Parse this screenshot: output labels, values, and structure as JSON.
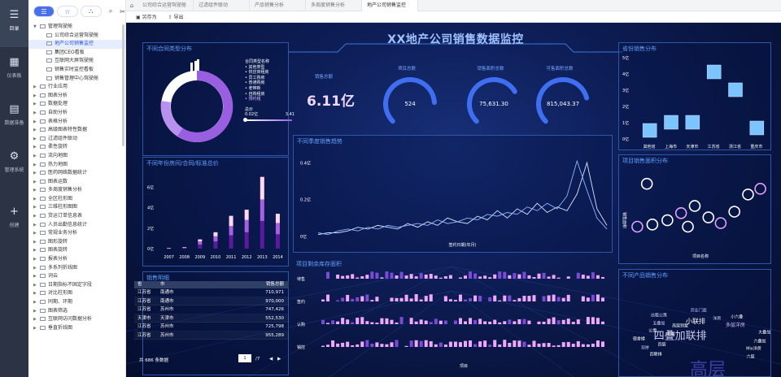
{
  "rail": {
    "items": [
      {
        "label": "目录",
        "icon": "☰"
      },
      {
        "label": "仪表板",
        "icon": "▦"
      },
      {
        "label": "数据准备",
        "icon": "▤"
      },
      {
        "label": "管理系统",
        "icon": "⚙"
      },
      {
        "label": "创建",
        "icon": "+"
      }
    ]
  },
  "tree": {
    "nodes": [
      {
        "label": "管理驾驶舱",
        "level": 0,
        "open": true
      },
      {
        "label": "公司综合运营驾驶舱",
        "level": 1
      },
      {
        "label": "地产公司销售监控",
        "level": 1,
        "selected": true
      },
      {
        "label": "集团CEO看板",
        "level": 1
      },
      {
        "label": "互联网大屏驾驶舱",
        "level": 1
      },
      {
        "label": "销售实时监控看板",
        "level": 1
      },
      {
        "label": "销售管理中心驾驶舱",
        "level": 1
      },
      {
        "label": "行业应用",
        "level": 0
      },
      {
        "label": "图表分析",
        "level": 0
      },
      {
        "label": "数据处理",
        "level": 0
      },
      {
        "label": "自助分析",
        "level": 0
      },
      {
        "label": "表格分析",
        "level": 0
      },
      {
        "label": "高级图表特性数据",
        "level": 0
      },
      {
        "label": "过滤组件联动",
        "level": 0
      },
      {
        "label": "柔性旋转",
        "level": 0
      },
      {
        "label": "流向地图",
        "level": 0
      },
      {
        "label": "热力地图",
        "level": 0
      },
      {
        "label": "医药网络数据统计",
        "level": 0
      },
      {
        "label": "图表运数",
        "level": 0
      },
      {
        "label": "多周度销售分析",
        "level": 0
      },
      {
        "label": "全区柱形图",
        "level": 0
      },
      {
        "label": "三维柱形图图",
        "level": 0
      },
      {
        "label": "货运订单信息表",
        "level": 0
      },
      {
        "label": "人员出勤信息统计",
        "level": 0
      },
      {
        "label": "常规业务分析",
        "level": 0
      },
      {
        "label": "图形旋转",
        "level": 0
      },
      {
        "label": "图表旋转",
        "level": 0
      },
      {
        "label": "报表分析",
        "level": 0
      },
      {
        "label": "多系列折线图",
        "level": 0
      },
      {
        "label": "词云",
        "level": 0
      },
      {
        "label": "日期指标不固定字段",
        "level": 0
      },
      {
        "label": "对比柱形图",
        "level": 0
      },
      {
        "label": "同期、环期",
        "level": 0
      },
      {
        "label": "图表筛选",
        "level": 0
      },
      {
        "label": "互联网访问数据分析",
        "level": 0
      },
      {
        "label": "垂直折线图",
        "level": 0
      }
    ]
  },
  "tabs": [
    "公司综合运营驾驶舱",
    "过滤组件联动",
    "产品销售分析",
    "多周度销售分析",
    "地产公司销售监控"
  ],
  "toolbar": {
    "save": "另存为",
    "export": "导出"
  },
  "dashboard": {
    "title": "XX地产公司销售数据监控",
    "donut": {
      "title": "不同合同类型分布",
      "legend_title": "合同类型名称",
      "legend": [
        "其他类型",
        "供应商租房",
        "员工购房",
        "普通购房",
        "老带新",
        "自购租房",
        "预约租"
      ],
      "total_label": "总价",
      "range_min": "0.02亿",
      "range_max": "3.41"
    },
    "kpis": [
      {
        "label": "销售总额",
        "value": "6.11亿"
      },
      {
        "label": "项目总数",
        "value": "524",
        "fraction": 0.82
      },
      {
        "label": "销售面积总数",
        "value": "75,631.30",
        "fraction": 0.72
      },
      {
        "label": "可售面积总数",
        "value": "815,043.37",
        "fraction": 0.78
      }
    ],
    "province": {
      "title": "省份销售分布",
      "ylabels": [
        "5亿",
        "4亿",
        "3亿",
        "2亿",
        "1亿",
        "0亿"
      ],
      "cities": [
        "其他省",
        "上海市",
        "天津市",
        "江苏省",
        "浙江省",
        "重庆市"
      ],
      "values": [
        0.5,
        1.0,
        1.0,
        4.1,
        3.0,
        0.65
      ]
    },
    "stack": {
      "title": "不同年份房间/合同/标准总价",
      "ylabels": [
        "6亿",
        "4亿",
        "2亿",
        "0亿"
      ],
      "years": [
        "2007",
        "2008",
        "2009",
        "2010",
        "2011",
        "2012",
        "2013",
        "2014"
      ],
      "values": [
        [
          0.02,
          0.02,
          0.02
        ],
        [
          0.05,
          0.05,
          0.05
        ],
        [
          0.4,
          0.3,
          0.2
        ],
        [
          0.7,
          0.5,
          0.4
        ],
        [
          1.3,
          0.9,
          1.0
        ],
        [
          1.6,
          1.2,
          1.0
        ],
        [
          2.7,
          2.1,
          2.2
        ],
        [
          1.4,
          1.1,
          0.9
        ]
      ]
    },
    "trend": {
      "title": "不同季度销售趋势",
      "ylabels": [
        "0.4亿",
        "0.2亿",
        "0亿"
      ],
      "xlabel": "签约日期(年月)",
      "series_a": [
        0.01,
        0.02,
        0.02,
        0.03,
        0.05,
        0.04,
        0.06,
        0.05,
        0.04,
        0.07,
        0.05,
        0.08,
        0.06,
        0.1,
        0.08,
        0.07,
        0.11,
        0.09,
        0.14,
        0.1,
        0.15,
        0.12,
        0.18,
        0.13,
        0.16,
        0.14,
        0.23,
        0.4,
        0.15,
        0.06
      ],
      "series_b": [
        0.02,
        0.01,
        0.03,
        0.04,
        0.03,
        0.05,
        0.04,
        0.06,
        0.05,
        0.06,
        0.07,
        0.06,
        0.09,
        0.07,
        0.08,
        0.1,
        0.09,
        0.12,
        0.11,
        0.13,
        0.12,
        0.16,
        0.14,
        0.18,
        0.15,
        0.22,
        0.41,
        0.25,
        0.1,
        0.04
      ]
    },
    "area": {
      "title": "项目销售面积分布",
      "ylabel": "销售面积",
      "xlabel": "项目名称",
      "points": [
        [
          0.05,
          0.25
        ],
        [
          0.16,
          0.28
        ],
        [
          0.27,
          0.34
        ],
        [
          0.37,
          0.44
        ],
        [
          0.47,
          0.54
        ],
        [
          0.57,
          0.38
        ],
        [
          0.66,
          0.3
        ],
        [
          0.76,
          0.46
        ],
        [
          0.86,
          0.7
        ],
        [
          0.95,
          0.78
        ],
        [
          0.12,
          0.85
        ],
        [
          0.42,
          0.25
        ]
      ]
    },
    "table": {
      "title": "销售明细",
      "headers": [
        "省",
        "市",
        "销售总额"
      ],
      "rows": [
        [
          "江苏省",
          "南通市",
          "710,971"
        ],
        [
          "江苏省",
          "南通市",
          "970,000"
        ],
        [
          "江苏省",
          "苏州市",
          "747,426"
        ],
        [
          "天津市",
          "天津市",
          "552,530"
        ],
        [
          "江苏省",
          "苏州市",
          "725,798"
        ],
        [
          "江苏省",
          "苏州市",
          "955,289"
        ]
      ],
      "footer": "共 686 条数据",
      "page": "1",
      "pages": "/7"
    },
    "inventory": {
      "title": "项目剩余库存面积",
      "rows": [
        "待售",
        "签约",
        "认购",
        "销控"
      ],
      "xlabel": "项目"
    },
    "wordcloud": {
      "title": "不同产品销售分布",
      "words": [
        {
          "t": "高层",
          "s": 22,
          "x": 58,
          "y": 93,
          "c": "#3c3ea8"
        },
        {
          "t": "四叠加联排",
          "s": 13,
          "x": 40,
          "y": 62,
          "c": "#c9c9ee"
        },
        {
          "t": "小联排",
          "s": 8,
          "x": 50,
          "y": 48,
          "c": "#ffffff"
        },
        {
          "t": "多层洋房",
          "s": 6,
          "x": 76,
          "y": 52,
          "c": "#d0c0ff"
        },
        {
          "t": "出租公寓",
          "s": 5,
          "x": 26,
          "y": 43,
          "c": "#e0d8ff"
        },
        {
          "t": "商业门面",
          "s": 5,
          "x": 52,
          "y": 38,
          "c": "#b8b8ff"
        },
        {
          "t": "小六叠",
          "s": 5,
          "x": 77,
          "y": 44,
          "c": "#ffffff"
        },
        {
          "t": "公寓",
          "s": 5,
          "x": 22,
          "y": 57,
          "c": "#ffffff"
        },
        {
          "t": "五叠加",
          "s": 5,
          "x": 26,
          "y": 50,
          "c": "#d8d0ff"
        },
        {
          "t": "高层别墅",
          "s": 5,
          "x": 40,
          "y": 53,
          "c": "#ffffff"
        },
        {
          "t": "多层",
          "s": 5,
          "x": 34,
          "y": 60,
          "c": "#ffffff"
        },
        {
          "t": "宿舍楼",
          "s": 5,
          "x": 13,
          "y": 65,
          "c": "#ffffff"
        },
        {
          "t": "双拼",
          "s": 5,
          "x": 17,
          "y": 73,
          "c": "#d0d0ff"
        },
        {
          "t": "四层",
          "s": 5,
          "x": 28,
          "y": 70,
          "c": "#ffffff"
        },
        {
          "t": "四联排",
          "s": 5,
          "x": 24,
          "y": 79,
          "c": "#ffffff"
        },
        {
          "t": "六叠加",
          "s": 5,
          "x": 92,
          "y": 67,
          "c": "#ffffff"
        },
        {
          "t": "Mix洋房",
          "s": 5,
          "x": 88,
          "y": 74,
          "c": "#ffffff"
        },
        {
          "t": "六层",
          "s": 5,
          "x": 86,
          "y": 81,
          "c": "#ffffff"
        },
        {
          "t": "洋房",
          "s": 5,
          "x": 64,
          "y": 46,
          "c": "#d8d8ff"
        },
        {
          "t": "大叠加",
          "s": 5,
          "x": 95,
          "y": 59,
          "c": "#ffffff"
        }
      ]
    }
  },
  "colors": {
    "accent": "#4a6fe8",
    "panel_title": "#5fa0ff",
    "donut": "#9a5fe0",
    "bar_light": "#7bc4ff",
    "line": "#c8d8ff",
    "circle": "#e0c0ff"
  }
}
